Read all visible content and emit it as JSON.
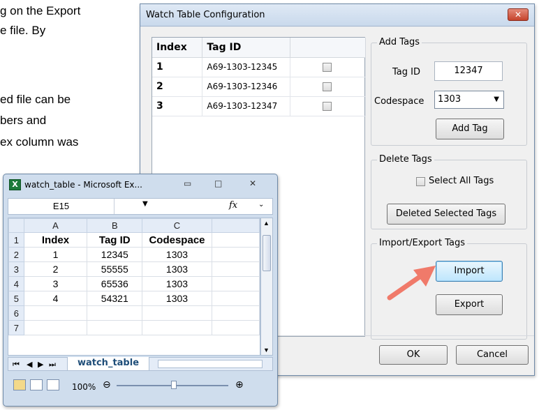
{
  "document": {
    "lines": [
      "g on the Export",
      "e file.  By",
      "ed file can be",
      "bers and",
      "ex column was"
    ]
  },
  "dialog": {
    "title": "Watch Table Configuration",
    "close_glyph": "✕",
    "grid": {
      "headers": [
        "Index",
        "Tag ID",
        ""
      ],
      "rows": [
        {
          "index": "1",
          "tag_id": "A69-1303-12345",
          "checked": false
        },
        {
          "index": "2",
          "tag_id": "A69-1303-12346",
          "checked": false
        },
        {
          "index": "3",
          "tag_id": "A69-1303-12347",
          "checked": false
        }
      ]
    },
    "add_tags": {
      "title": "Add Tags",
      "tag_id_label": "Tag ID",
      "tag_id_value": "12347",
      "codespace_label": "Codespace",
      "codespace_value": "1303",
      "add_button": "Add Tag"
    },
    "delete_tags": {
      "title": "Delete Tags",
      "select_all_label": "Select All Tags",
      "select_all_checked": false,
      "delete_button": "Deleted Selected Tags"
    },
    "import_export": {
      "title": "Import/Export Tags",
      "import_button": "Import",
      "export_button": "Export"
    },
    "ok_button": "OK",
    "cancel_button": "Cancel"
  },
  "excel": {
    "title": "watch_table - Microsoft Ex...",
    "name_box": "E15",
    "fx_label": "fx",
    "columns": [
      "A",
      "B",
      "C"
    ],
    "rows": [
      {
        "n": "1",
        "cells": [
          "Index",
          "Tag ID",
          "Codespace"
        ]
      },
      {
        "n": "2",
        "cells": [
          "1",
          "12345",
          "1303"
        ]
      },
      {
        "n": "3",
        "cells": [
          "2",
          "55555",
          "1303"
        ]
      },
      {
        "n": "4",
        "cells": [
          "3",
          "65536",
          "1303"
        ]
      },
      {
        "n": "5",
        "cells": [
          "4",
          "54321",
          "1303"
        ]
      },
      {
        "n": "6",
        "cells": [
          "",
          "",
          ""
        ]
      },
      {
        "n": "7",
        "cells": [
          "",
          "",
          ""
        ]
      }
    ],
    "sheet_tab": "watch_table",
    "zoom": "100%"
  },
  "colors": {
    "arrow": "#f07a6a"
  }
}
